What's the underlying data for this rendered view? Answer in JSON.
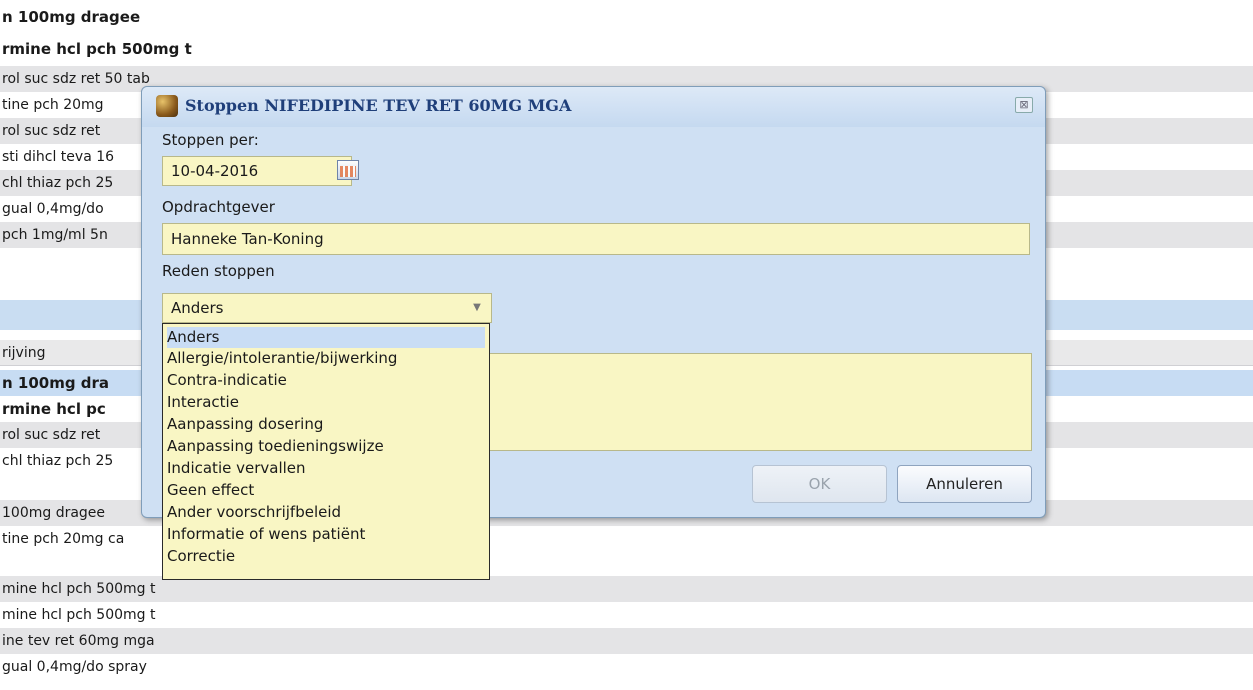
{
  "background_rows": [
    "n 100mg dragee",
    "rmine hcl pch 500mg t",
    "rol suc sdz ret 50 tab",
    "tine pch 20mg",
    "rol suc sdz ret",
    "sti dihcl teva 16",
    "chl thiaz pch 25",
    "gual 0,4mg/do",
    " pch 1mg/ml 5n",
    "",
    "rijving",
    "n 100mg dra",
    "rmine hcl pc",
    "rol suc sdz ret",
    "chl thiaz pch 25",
    " 100mg dragee",
    "tine pch 20mg ca",
    "mine hcl pch 500mg t",
    "mine hcl pch 500mg t",
    "ine tev ret 60mg mga",
    "gual 0,4mg/do spray"
  ],
  "dialog": {
    "title": "Stoppen NIFEDIPINE TEV RET 60MG MGA",
    "close_glyph": "⊠",
    "stop_date_label": "Stoppen per:",
    "stop_date_value": "10-04-2016",
    "requester_label": "Opdrachtgever",
    "requester_value": "Hanneke Tan-Koning",
    "reason_label": "Reden stoppen",
    "reason_value": "Anders",
    "reason_options": [
      "Anders",
      "Allergie/intolerantie/bijwerking",
      "Contra-indicatie",
      "Interactie",
      "Aanpassing dosering",
      "Aanpassing toedieningswijze",
      "Indicatie vervallen",
      "Geen effect",
      "Ander voorschrijfbeleid",
      "Informatie of wens patiënt",
      "Correctie"
    ],
    "ok_label": "OK",
    "cancel_label": "Annuleren"
  }
}
